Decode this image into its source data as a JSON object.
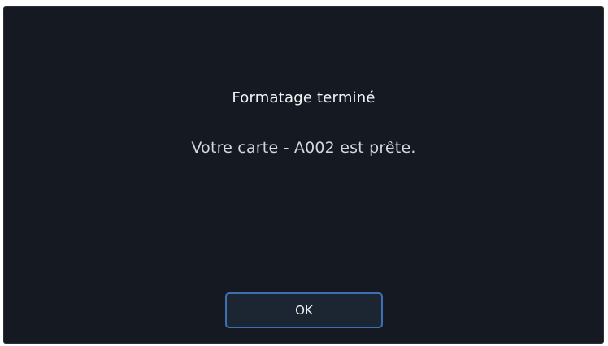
{
  "dialog": {
    "title": "Formatage terminé",
    "message": "Votre carte - A002 est prête.",
    "ok_label": "OK"
  },
  "colors": {
    "background": "#151a22",
    "button_border": "#3f6fb3",
    "text": "#f2f3f5"
  }
}
